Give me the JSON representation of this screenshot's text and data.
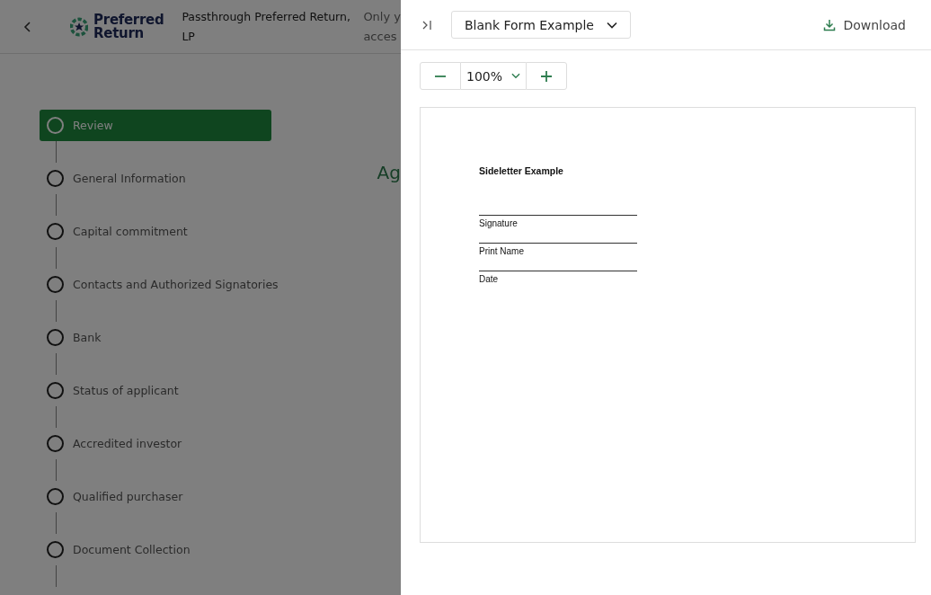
{
  "header": {
    "brand": "Preferred\nReturn",
    "fund_name": "Passthrough Preferred Return, LP",
    "notice_line_1": "Only y",
    "notice_line_2": "acces"
  },
  "steps": [
    {
      "label": "Review",
      "selected": true
    },
    {
      "label": "General Information",
      "selected": false
    },
    {
      "label": "Capital commitment",
      "selected": false
    },
    {
      "label": "Contacts and Authorized Signatories",
      "selected": false
    },
    {
      "label": "Bank",
      "selected": false
    },
    {
      "label": "Status of applicant",
      "selected": false
    },
    {
      "label": "Accredited investor",
      "selected": false
    },
    {
      "label": "Qualified purchaser",
      "selected": false
    },
    {
      "label": "Document Collection",
      "selected": false
    }
  ],
  "content_heading": "Ag",
  "preview": {
    "document_select": "Blank Form Example",
    "download": "Download",
    "zoom": "100%",
    "document": {
      "title": "Sideletter Example",
      "fields": [
        "Signature",
        "Print Name",
        "Date"
      ]
    }
  }
}
